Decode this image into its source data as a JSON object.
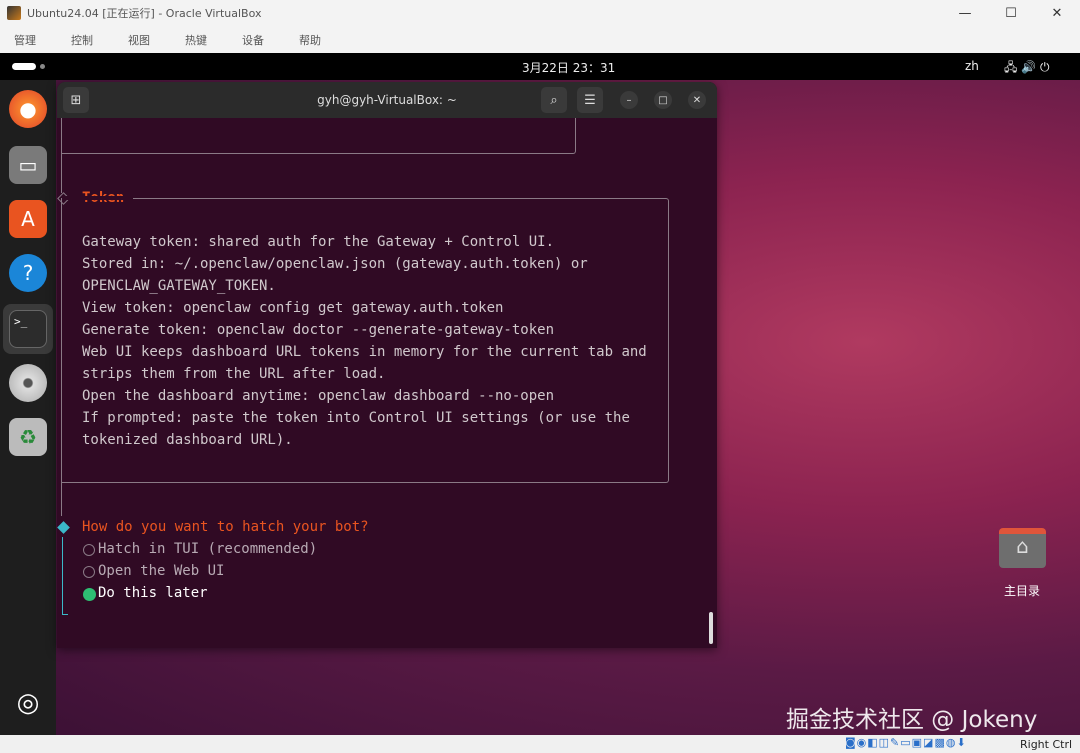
{
  "vbox": {
    "title": "Ubuntu24.04 [正在运行] - Oracle VirtualBox",
    "menu": [
      "管理",
      "控制",
      "视图",
      "热键",
      "设备",
      "帮助"
    ],
    "host_key": "Right Ctrl"
  },
  "topbar": {
    "datetime": "3月22日  23：31",
    "lang": "zh"
  },
  "terminal": {
    "title": "gyh@gyh-VirtualBox: ~",
    "token_title": "Token",
    "token_lines": [
      "Gateway token: shared auth for the Gateway + Control UI.",
      "Stored in: ~/.openclaw/openclaw.json (gateway.auth.token) or",
      "OPENCLAW_GATEWAY_TOKEN.",
      "View token: openclaw config get gateway.auth.token",
      "Generate token: openclaw doctor --generate-gateway-token",
      "Web UI keeps dashboard URL tokens in memory for the current tab and",
      "strips them from the URL after load.",
      "Open the dashboard anytime: openclaw dashboard --no-open",
      "If prompted: paste the token into Control UI settings (or use the",
      "tokenized dashboard URL)."
    ],
    "question": "How do you want to hatch your bot?",
    "options": [
      {
        "label": "Hatch in TUI (recommended)",
        "selected": false
      },
      {
        "label": "Open the Web UI",
        "selected": false
      },
      {
        "label": "Do this later",
        "selected": true
      }
    ]
  },
  "desktop": {
    "home_label": "主目录"
  },
  "watermark": "掘金技术社区 @ Jokeny",
  "colors": {
    "accent": "#e95420",
    "option_selected": "#2ebd73",
    "question_marker": "#3bb8c8"
  }
}
